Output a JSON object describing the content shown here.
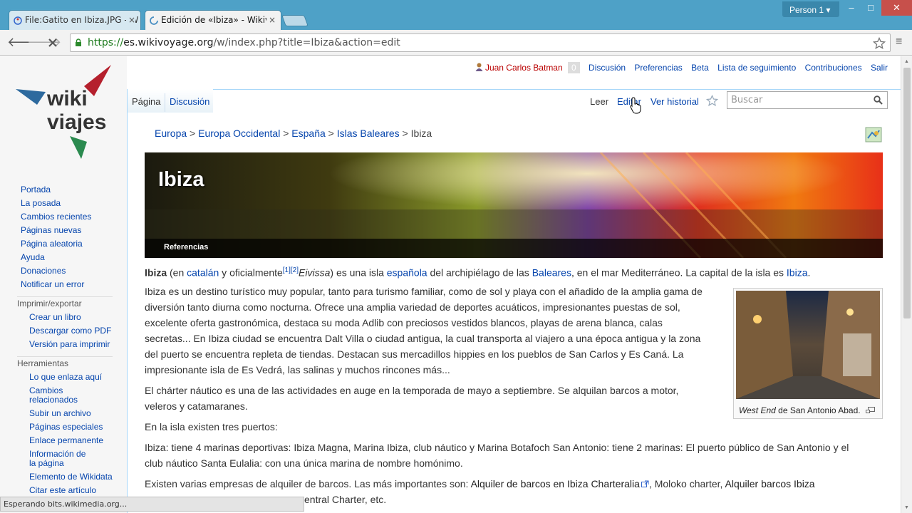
{
  "browser": {
    "tabs": [
      {
        "title": "File:Gatito en Ibiza.JPG - W",
        "close": "×"
      },
      {
        "title": "Edición de «Ibiza» - Wikivi",
        "close": "×"
      }
    ],
    "profile": "Person 1",
    "window_controls": {
      "minimize": "–",
      "maximize": "□",
      "close": "✕"
    },
    "url_scheme": "https://",
    "url_host": "es.wikivoyage.org",
    "url_path": "/w/index.php?title=Ibiza&action=edit",
    "status": "Esperando bits.wikimedia.org..."
  },
  "site": {
    "logo_text_1": "wiki",
    "logo_text_2": "viajes"
  },
  "userbar": {
    "user": "Juan Carlos Batman",
    "notifications": "0",
    "links": [
      "Discusión",
      "Preferencias",
      "Beta",
      "Lista de seguimiento",
      "Contribuciones",
      "Salir"
    ]
  },
  "page_tabs": {
    "left": [
      "Página",
      "Discusión"
    ],
    "right": [
      "Leer",
      "Editar",
      "Ver historial"
    ],
    "search_placeholder": "Buscar"
  },
  "sidebar": {
    "nav": [
      "Portada",
      "La posada",
      "Cambios recientes",
      "Páginas nuevas",
      "Página aleatoria",
      "Ayuda",
      "Donaciones",
      "Notificar un error"
    ],
    "print_heading": "Imprimir/exportar",
    "print": [
      "Crear un libro",
      "Descargar como PDF",
      "Versión para imprimir"
    ],
    "tools_heading": "Herramientas",
    "tools": [
      "Lo que enlaza aquí",
      "Cambios relacionados",
      "Subir un archivo",
      "Páginas especiales",
      "Enlace permanente",
      "Información de la página",
      "Elemento de Wikidata",
      "Citar este artículo"
    ]
  },
  "breadcrumb": {
    "links": [
      "Europa",
      "Europa Occidental",
      "España",
      "Islas Baleares"
    ],
    "sep": " > ",
    "current": "Ibiza"
  },
  "banner": {
    "title": "Ibiza",
    "refs": "Referencias"
  },
  "article": {
    "p1": {
      "bold": "Ibiza",
      "t1": " (en ",
      "l1": "catalán",
      "t2": " y oficialmente",
      "refs": "[1][2]",
      "italic": "Eivissa",
      "t3": ") es una isla ",
      "l2": "española",
      "t4": " del archipiélago de las ",
      "l3": "Baleares",
      "t5": ", en el mar Mediterráneo. La capital de la isla es ",
      "l4": "Ibiza",
      "t6": "."
    },
    "p2": [
      "Ibiza es un destino turístico muy popular, tanto para turismo familiar, como de sol y playa con el añadido de la amplia gama de",
      "diversión tanto diurna como nocturna. Ofrece una amplia variedad de deportes acuáticos, impresionantes puestas de sol,",
      "excelente oferta gastronómica, destaca su moda Adlib con preciosos vestidos blancos, playas de arena blanca, calas",
      "secretas... En Ibiza ciudad se encuentra Dalt Villa o ciudad antigua, la cual transporta al viajero a una época antigua y la zona",
      "del puerto se encuentra repleta de tiendas. Destacan sus mercadillos hippies en los pueblos de San Carlos y Es Caná. La",
      "impresionante isla de Es Vedrá, las salinas y muchos rincones más..."
    ],
    "p3": [
      "El chárter náutico es una de las actividades en auge en la temporada de mayo a septiembre. Se alquilan barcos a motor,",
      "veleros y catamaranes."
    ],
    "p4": "En la isla existen tres puertos:",
    "p5": [
      "Ibiza: tiene 4 marinas deportivas: Ibiza Magna, Marina Ibiza, club náutico y Marina Botafoch San Antonio: tiene 2 marinas: El puerto público de San Antonio y el",
      "club náutico Santa Eulalia: con una única marina de nombre homónimo."
    ],
    "p6a": "Existen varias empresas de alquiler de barcos. Las más importantes son: ",
    "p6l1": "Alquiler de barcos en Ibiza Charteralia",
    "p6b": ", Moloko charter, ",
    "p6l2": "Alquiler barcos Ibiza",
    "p6c": "entral Charter, etc."
  },
  "thumbnail": {
    "caption_italic": "West End",
    "caption_rest": " de San Antonio Abad."
  }
}
